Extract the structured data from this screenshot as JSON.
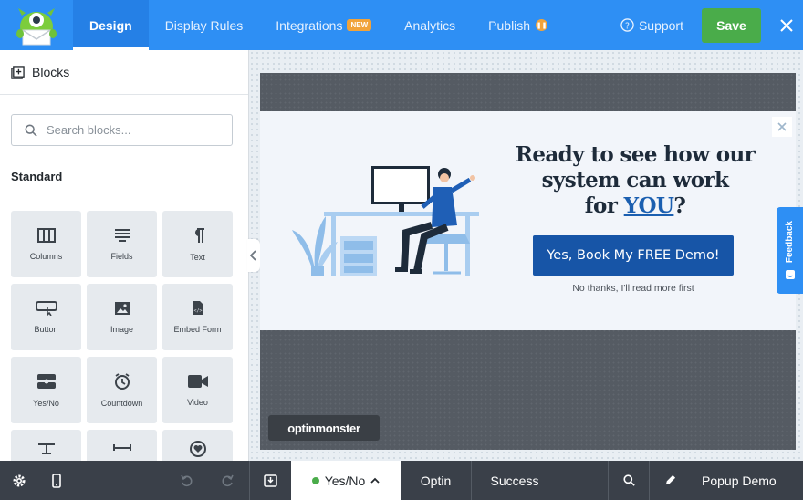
{
  "topnav": {
    "tabs": [
      {
        "label": "Design",
        "active": true
      },
      {
        "label": "Display Rules"
      },
      {
        "label": "Integrations",
        "badge": "NEW"
      },
      {
        "label": "Analytics"
      },
      {
        "label": "Publish"
      }
    ],
    "support_label": "Support",
    "save_label": "Save",
    "colors": {
      "bar": "#2e8ff4",
      "save": "#4aac4a",
      "badge": "#f1a33a"
    }
  },
  "sidebar": {
    "title": "Blocks",
    "search_placeholder": "Search blocks...",
    "section_title": "Standard",
    "blocks": [
      {
        "label": "Columns",
        "icon": "columns-icon"
      },
      {
        "label": "Fields",
        "icon": "fields-icon"
      },
      {
        "label": "Text",
        "icon": "paragraph-icon"
      },
      {
        "label": "Button",
        "icon": "button-icon"
      },
      {
        "label": "Image",
        "icon": "image-icon"
      },
      {
        "label": "Embed Form",
        "icon": "embed-form-icon"
      },
      {
        "label": "Yes/No",
        "icon": "yes-no-icon"
      },
      {
        "label": "Countdown",
        "icon": "countdown-icon"
      },
      {
        "label": "Video",
        "icon": "video-icon"
      }
    ]
  },
  "popup": {
    "headline_line1": "Ready to see how our",
    "headline_line2": "system can work",
    "headline_line3_prefix": "for ",
    "headline_emphasis": "YOU",
    "headline_suffix": "?",
    "cta_label": "Yes, Book My FREE Demo!",
    "decline_label": "No thanks, I'll read more first",
    "brand_label": "optinmonster"
  },
  "feedback_label": "Feedback",
  "bottombar": {
    "views": [
      {
        "label": "Yes/No",
        "active": true
      },
      {
        "label": "Optin"
      },
      {
        "label": "Success"
      }
    ],
    "campaign_name": "Popup Demo"
  }
}
